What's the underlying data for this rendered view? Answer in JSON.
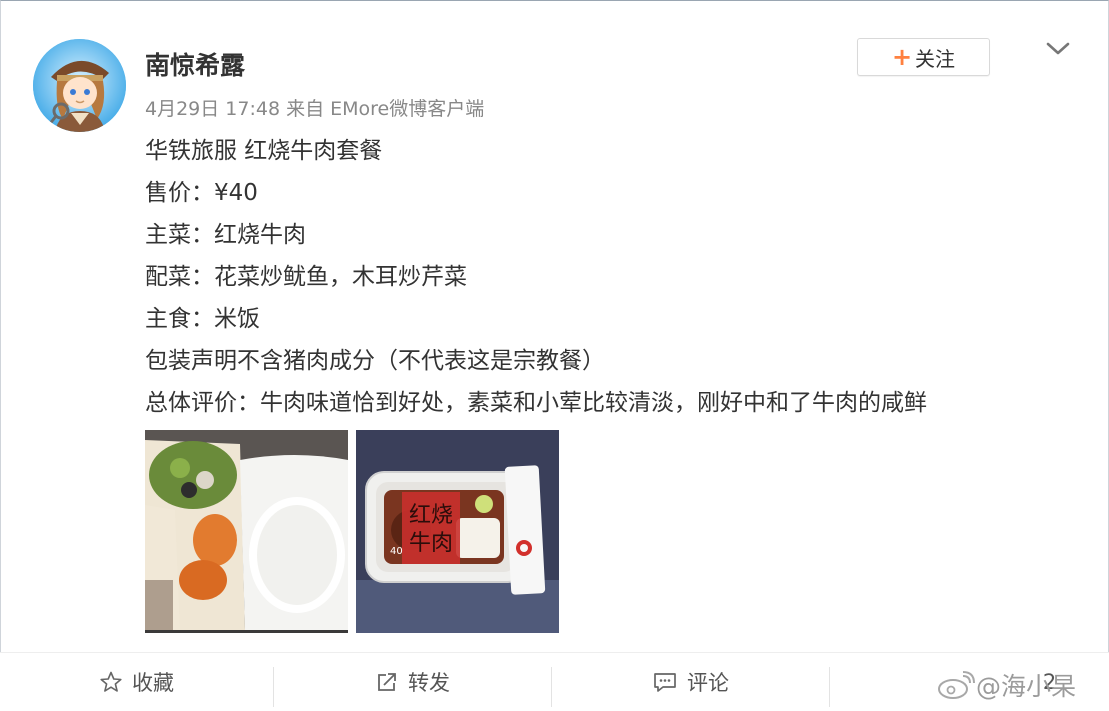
{
  "post": {
    "username": "南惊希露",
    "meta": "4月29日 17:48 来自 EMore微博客户端",
    "follow_plus": "+",
    "follow_label": "关注",
    "lines": [
      "华铁旅服 红烧牛肉套餐",
      "售价：¥40",
      "主菜：红烧牛肉",
      "配菜：花菜炒鱿鱼，木耳炒芹菜",
      "主食：米饭",
      "包装声明不含猪肉成分（不代表这是宗教餐）",
      "总体评价：牛肉味道恰到好处，素菜和小荤比较清淡，刚好中和了牛肉的咸鲜"
    ],
    "photo2_label_line1": "红烧",
    "photo2_label_line2": "牛肉",
    "photo2_price": "40"
  },
  "actions": {
    "favorite": "收藏",
    "repost": "转发",
    "comment": "评论",
    "like_count": "2"
  },
  "watermark": "@海小杲",
  "icons": [
    "avatar-image",
    "chevron-down-icon",
    "star-icon",
    "repost-icon",
    "comment-icon",
    "weibo-logo-icon"
  ],
  "colors": {
    "accent": "#ff8140",
    "text": "#333333",
    "meta": "#888888"
  }
}
